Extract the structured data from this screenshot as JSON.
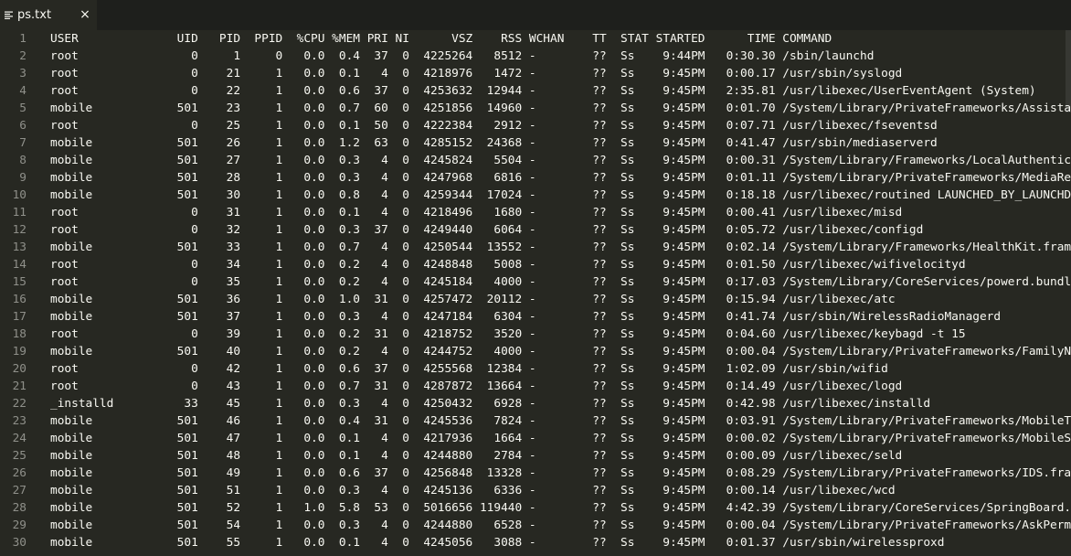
{
  "tab": {
    "title": "ps.txt",
    "close": "×",
    "icon": "text-file-icon"
  },
  "colors": {
    "background": "#272822",
    "tabbar": "#1e1f1c",
    "text": "#f8f8f2",
    "gutter": "#8f908a"
  },
  "lines": [
    {
      "num": "1",
      "text": "USER              UID   PID  PPID  %CPU %MEM PRI NI      VSZ    RSS WCHAN    TT  STAT STARTED      TIME COMMAND"
    },
    {
      "num": "2",
      "text": "root                0     1     0   0.0  0.4  37  0  4225264   8512 -        ??  Ss    9:44PM   0:30.30 /sbin/launchd"
    },
    {
      "num": "3",
      "text": "root                0    21     1   0.0  0.1   4  0  4218976   1472 -        ??  Ss    9:45PM   0:00.17 /usr/sbin/syslogd"
    },
    {
      "num": "4",
      "text": "root                0    22     1   0.0  0.6  37  0  4253632  12944 -        ??  Ss    9:45PM   2:35.81 /usr/libexec/UserEventAgent (System)"
    },
    {
      "num": "5",
      "text": "mobile            501    23     1   0.0  0.7  60  0  4251856  14960 -        ??  Ss    9:45PM   0:01.70 /System/Library/PrivateFrameworks/AssistantServices.framework/assistantd"
    },
    {
      "num": "6",
      "text": "root                0    25     1   0.0  0.1  50  0  4222384   2912 -        ??  Ss    9:45PM   0:07.71 /usr/libexec/fseventsd"
    },
    {
      "num": "7",
      "text": "mobile            501    26     1   0.0  1.2  63  0  4285152  24368 -        ??  Ss    9:45PM   0:41.47 /usr/sbin/mediaserverd"
    },
    {
      "num": "8",
      "text": "mobile            501    27     1   0.0  0.3   4  0  4245824   5504 -        ??  Ss    9:45PM   0:00.31 /System/Library/Frameworks/LocalAuthentication.framework"
    },
    {
      "num": "9",
      "text": "mobile            501    28     1   0.0  0.3   4  0  4247968   6816 -        ??  Ss    9:45PM   0:01.11 /System/Library/PrivateFrameworks/MediaRemote.framework"
    },
    {
      "num": "10",
      "text": "mobile            501    30     1   0.0  0.8   4  0  4259344  17024 -        ??  Ss    9:45PM   0:18.18 /usr/libexec/routined LAUNCHED_BY_LAUNCHD"
    },
    {
      "num": "11",
      "text": "root                0    31     1   0.0  0.1   4  0  4218496   1680 -        ??  Ss    9:45PM   0:00.41 /usr/libexec/misd"
    },
    {
      "num": "12",
      "text": "root                0    32     1   0.0  0.3  37  0  4249440   6064 -        ??  Ss    9:45PM   0:05.72 /usr/libexec/configd"
    },
    {
      "num": "13",
      "text": "mobile            501    33     1   0.0  0.7   4  0  4250544  13552 -        ??  Ss    9:45PM   0:02.14 /System/Library/Frameworks/HealthKit.framework"
    },
    {
      "num": "14",
      "text": "root                0    34     1   0.0  0.2   4  0  4248848   5008 -        ??  Ss    9:45PM   0:01.50 /usr/libexec/wifivelocityd"
    },
    {
      "num": "15",
      "text": "root                0    35     1   0.0  0.2   4  0  4245184   4000 -        ??  Ss    9:45PM   0:17.03 /System/Library/CoreServices/powerd.bundle"
    },
    {
      "num": "16",
      "text": "mobile            501    36     1   0.0  1.0  31  0  4257472  20112 -        ??  Ss    9:45PM   0:15.94 /usr/libexec/atc"
    },
    {
      "num": "17",
      "text": "mobile            501    37     1   0.0  0.3   4  0  4247184   6304 -        ??  Ss    9:45PM   0:41.74 /usr/sbin/WirelessRadioManagerd"
    },
    {
      "num": "18",
      "text": "root                0    39     1   0.0  0.2  31  0  4218752   3520 -        ??  Ss    9:45PM   0:04.60 /usr/libexec/keybagd -t 15"
    },
    {
      "num": "19",
      "text": "mobile            501    40     1   0.0  0.2   4  0  4244752   4000 -        ??  Ss    9:45PM   0:00.04 /System/Library/PrivateFrameworks/FamilyNotification.framework"
    },
    {
      "num": "20",
      "text": "root                0    42     1   0.0  0.6  37  0  4255568  12384 -        ??  Ss    9:45PM   1:02.09 /usr/sbin/wifid"
    },
    {
      "num": "21",
      "text": "root                0    43     1   0.0  0.7  31  0  4287872  13664 -        ??  Ss    9:45PM   0:14.49 /usr/libexec/logd"
    },
    {
      "num": "22",
      "text": "_installd          33    45     1   0.0  0.3   4  0  4250432   6928 -        ??  Ss    9:45PM   0:42.98 /usr/libexec/installd"
    },
    {
      "num": "23",
      "text": "mobile            501    46     1   0.0  0.4  31  0  4245536   7824 -        ??  Ss    9:45PM   0:03.91 /System/Library/PrivateFrameworks/MobileTimer.framework"
    },
    {
      "num": "24",
      "text": "mobile            501    47     1   0.0  0.1   4  0  4217936   1664 -        ??  Ss    9:45PM   0:00.02 /System/Library/PrivateFrameworks/MobileSoftwareUpdate.framework"
    },
    {
      "num": "25",
      "text": "mobile            501    48     1   0.0  0.1   4  0  4244880   2784 -        ??  Ss    9:45PM   0:00.09 /usr/libexec/seld"
    },
    {
      "num": "26",
      "text": "mobile            501    49     1   0.0  0.6  37  0  4256848  13328 -        ??  Ss    9:45PM   0:08.29 /System/Library/PrivateFrameworks/IDS.framework"
    },
    {
      "num": "27",
      "text": "mobile            501    51     1   0.0  0.3   4  0  4245136   6336 -        ??  Ss    9:45PM   0:00.14 /usr/libexec/wcd"
    },
    {
      "num": "28",
      "text": "mobile            501    52     1   1.0  5.8  53  0  5016656 119440 -        ??  Ss    9:45PM   4:42.39 /System/Library/CoreServices/SpringBoard.app/SpringBoard"
    },
    {
      "num": "29",
      "text": "mobile            501    54     1   0.0  0.3   4  0  4244880   6528 -        ??  Ss    9:45PM   0:00.04 /System/Library/PrivateFrameworks/AskPermission.framework"
    },
    {
      "num": "30",
      "text": "mobile            501    55     1   0.0  0.1   4  0  4245056   3088 -        ??  Ss    9:45PM   0:01.37 /usr/sbin/wirelessproxd"
    }
  ]
}
